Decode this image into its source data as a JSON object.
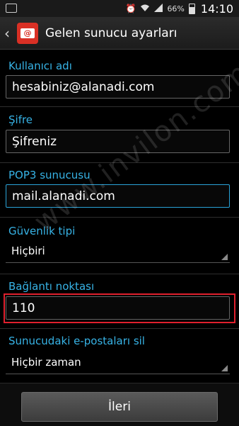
{
  "status_bar": {
    "battery_text": "66%",
    "time": "14:10",
    "battery_level": 0.66,
    "icons": [
      "screenshot-icon",
      "alarm-icon",
      "wifi-icon",
      "signal-icon",
      "battery-icon"
    ]
  },
  "action_bar": {
    "title": "Gelen sunucu ayarları",
    "back_icon": "back-arrow-icon",
    "app_icon": "email-app-icon"
  },
  "form": {
    "username": {
      "label": "Kullanıcı adı",
      "value": "hesabiniz@alanadi.com"
    },
    "password": {
      "label": "Şifre",
      "value": "Şifreniz"
    },
    "pop3_server": {
      "label": "POP3 sunucusu",
      "value": "mail.alanadi.com"
    },
    "security_type": {
      "label": "Güvenlik tipi",
      "value": "Hiçbiri"
    },
    "port": {
      "label": "Bağlantı noktası",
      "value": "110"
    },
    "delete_from_server": {
      "label": "Sunucudaki e-postaları sil",
      "value": "Hiçbir zaman"
    }
  },
  "next_button": {
    "label": "İleri"
  },
  "watermark": {
    "text": "www.invilon.com"
  },
  "colors": {
    "accent": "#37b3e6",
    "highlight": "#e0202d",
    "app_icon": "#d93025"
  }
}
